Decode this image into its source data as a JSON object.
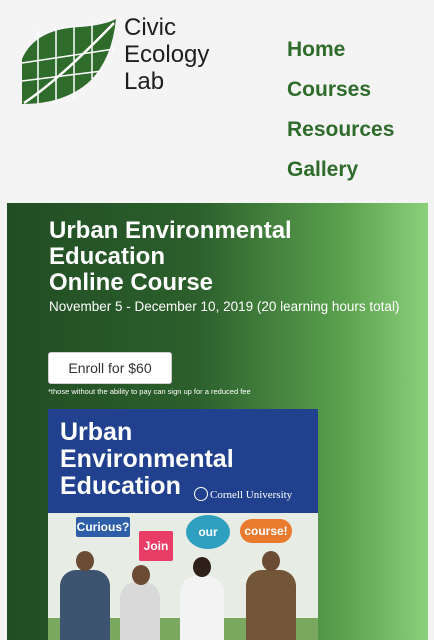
{
  "logo": {
    "line1": "Civic",
    "line2": "Ecology",
    "line3": "Lab",
    "mark_color": "#2f6b2a"
  },
  "nav": {
    "items": [
      "Home",
      "Courses",
      "Resources",
      "Gallery"
    ],
    "color": "#2f6b2a"
  },
  "hero": {
    "title_line1": "Urban Environmental",
    "title_line2": "Education",
    "title_line3": "Online Course",
    "dates": "November 5 - December 10, 2019 (20 learning hours total)",
    "enroll_label": "Enroll for $60",
    "fee_note": "*those without the ability to pay can sign up for a reduced fee"
  },
  "course_image": {
    "title_line1": "Urban",
    "title_line2": "Environmental",
    "title_line3": "Education",
    "institution": "Cornell University",
    "bubbles": [
      "Curious?",
      "Join",
      "our",
      "course!"
    ]
  }
}
